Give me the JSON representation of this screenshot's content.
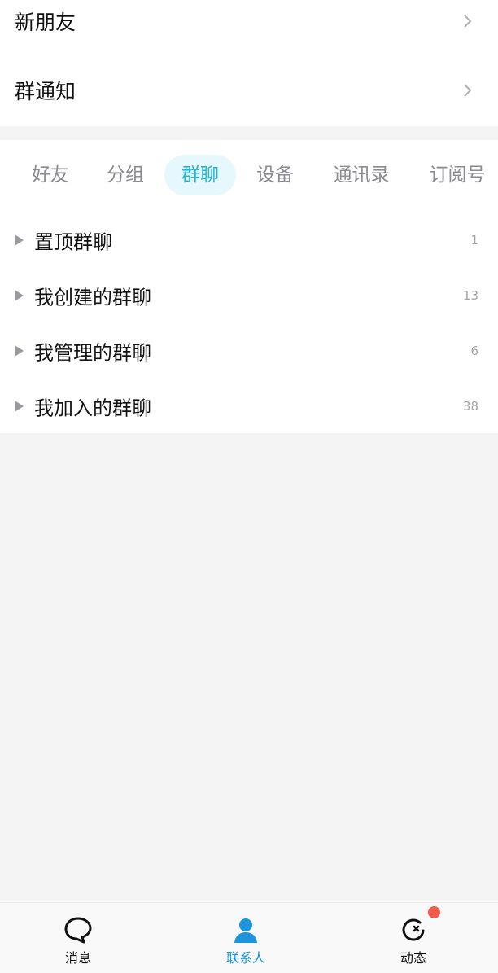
{
  "top_entries": [
    {
      "label": "新朋友"
    },
    {
      "label": "群通知"
    }
  ],
  "tabs": [
    "好友",
    "分组",
    "群聊",
    "设备",
    "通讯录",
    "订阅号"
  ],
  "active_tab": "群聊",
  "groups": [
    {
      "name": "置顶群聊",
      "count": "1"
    },
    {
      "name": "我创建的群聊",
      "count": "13"
    },
    {
      "name": "我管理的群聊",
      "count": "6"
    },
    {
      "name": "我加入的群聊",
      "count": "38"
    }
  ],
  "bottom_nav": [
    {
      "label": "消息",
      "icon": "chat-bubble-icon"
    },
    {
      "label": "联系人",
      "icon": "contacts-person-icon",
      "active": true
    },
    {
      "label": "动态",
      "icon": "moments-refresh-icon",
      "badge": true
    }
  ],
  "colors": {
    "accent": "#21b4d8",
    "accent_bg": "#e6f8fc",
    "nav_active": "#1c95dd",
    "badge": "#f25b4b"
  }
}
